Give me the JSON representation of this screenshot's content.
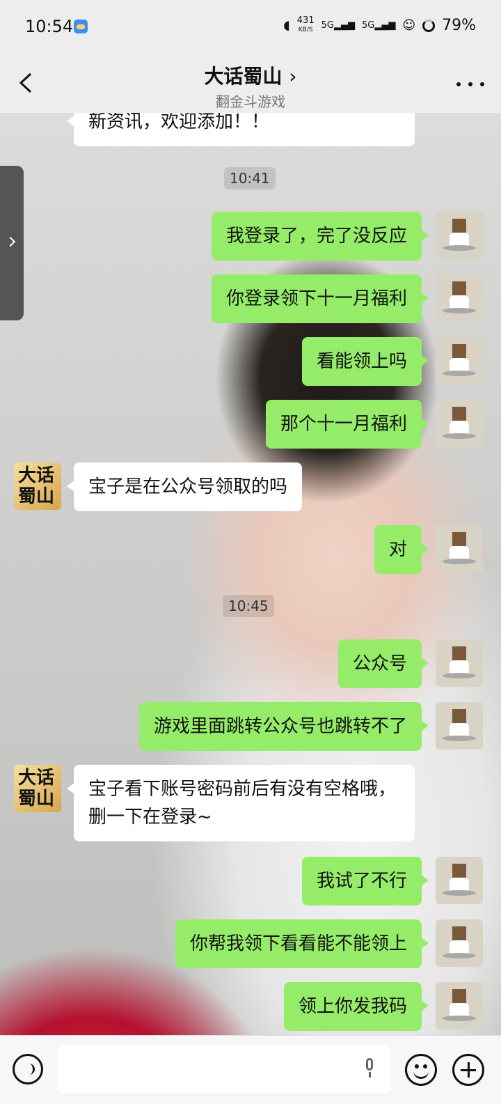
{
  "status_bar": {
    "time": "10:54",
    "net_speed_value": "431",
    "net_speed_unit": "KB/S",
    "signal1": "5G",
    "signal2": "5G",
    "battery": "79%"
  },
  "header": {
    "title": "大话蜀山",
    "chevron": "›",
    "subtitle": "翻金斗游戏"
  },
  "messages": [
    {
      "from": "other",
      "text": "新资讯，欢迎添加！！"
    },
    {
      "time": "10:41"
    },
    {
      "from": "me",
      "text": "我登录了，完了没反应"
    },
    {
      "from": "me",
      "text": "你登录领下十一月福利"
    },
    {
      "from": "me",
      "text": "看能领上吗"
    },
    {
      "from": "me",
      "text": "那个十一月福利"
    },
    {
      "from": "other",
      "text": "宝子是在公众号领取的吗"
    },
    {
      "from": "me",
      "text": "对"
    },
    {
      "time": "10:45"
    },
    {
      "from": "me",
      "text": "公众号"
    },
    {
      "from": "me",
      "text": "游戏里面跳转公众号也跳转不了"
    },
    {
      "from": "other",
      "text": "宝子看下账号密码前后有没有空格哦，删一下在登录~"
    },
    {
      "from": "me",
      "text": "我试了不行"
    },
    {
      "from": "me",
      "text": "你帮我领下看看能不能领上"
    },
    {
      "from": "me",
      "text": "领上你发我码"
    }
  ],
  "other_avatar_text": "大话蜀山",
  "input": {
    "placeholder": ""
  },
  "colors": {
    "my_bubble": "#95ec69",
    "other_bubble": "#ffffff",
    "background": "#ededed"
  }
}
